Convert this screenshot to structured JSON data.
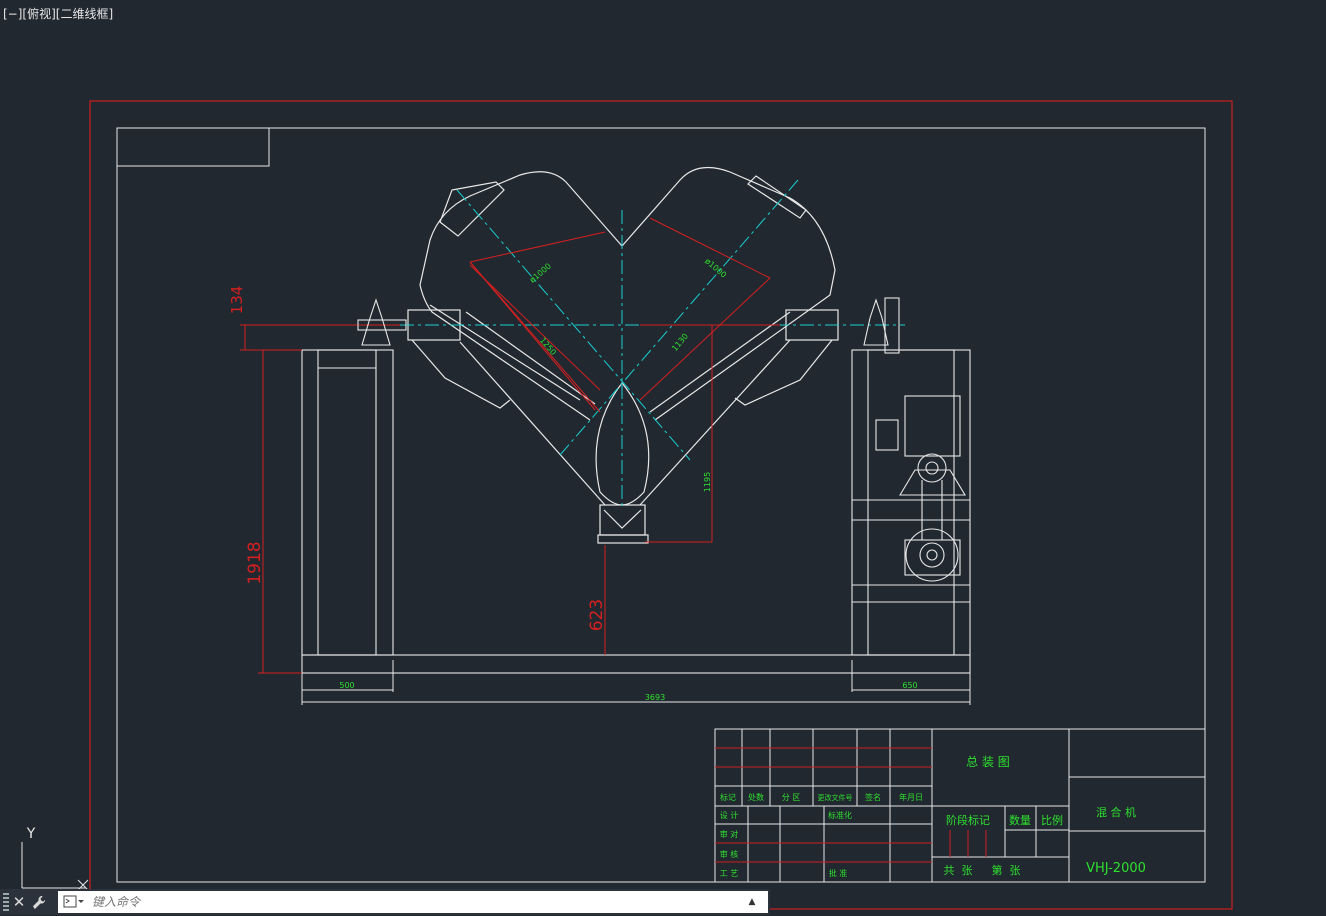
{
  "viewport": {
    "label": "[−][俯视][二维线框]"
  },
  "ucs": {
    "y_label": "Y",
    "icon": "ucs-axis-icon"
  },
  "dimensions": {
    "height_134": "134",
    "height_1918": "1918",
    "height_623": "623",
    "width_500": "500",
    "width_3693": "3693",
    "width_650": "650",
    "diam_left": "ø1000",
    "diam_right": "ø1000",
    "len_1250": "1250",
    "len_1130": "1130",
    "len_1195": "1195"
  },
  "title_block": {
    "headers": [
      "标记",
      "处数",
      "分 区",
      "更改文件号",
      "签名",
      "年月日"
    ],
    "rows": [
      "设 计",
      "审 对",
      "审 核",
      "工 艺"
    ],
    "standardization": "标准化",
    "approve": "批 准",
    "drawing_name": "总 装 图",
    "stage_mark": "阶段标记",
    "quantity": "数量",
    "scale": "比例",
    "sheets_total": "共  张",
    "sheet_no": "第  张",
    "product_name": "混 合 机",
    "model": "VHJ-2000"
  },
  "command": {
    "placeholder": "键入命令"
  },
  "icons": {
    "close": "close-icon",
    "customize": "wrench-icon",
    "prompt": "command-prompt-icon",
    "history": "chevron-up-icon"
  },
  "colors": {
    "background": "#212830",
    "frame_red": "#cc1f1f",
    "line_white": "#e8e8e8",
    "center_cyan": "#1ad0d0",
    "text_green": "#2ee02e"
  }
}
